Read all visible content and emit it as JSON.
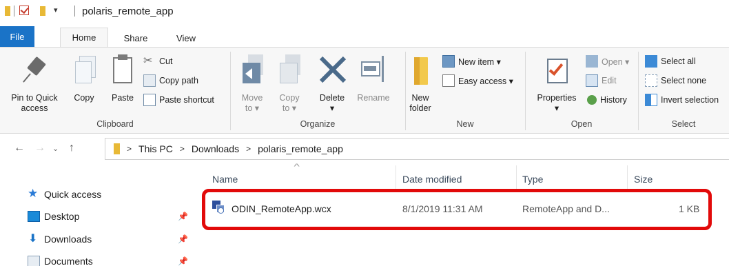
{
  "window": {
    "title": "polaris_remote_app",
    "qat_dropdown": "▾"
  },
  "ribbon_tabs": [
    {
      "label": "File"
    },
    {
      "label": "Home"
    },
    {
      "label": "Share"
    },
    {
      "label": "View"
    }
  ],
  "clipboard": {
    "label": "Clipboard",
    "pin_label_1": "Pin to Quick",
    "pin_label_2": "access",
    "copy_label": "Copy",
    "paste_label": "Paste",
    "cut_label": "Cut",
    "copy_path_label": "Copy path",
    "paste_shortcut_label": "Paste shortcut"
  },
  "organize": {
    "label": "Organize",
    "move_label": "Move",
    "move_sub": "to ▾",
    "copy_label": "Copy",
    "copy_sub": "to ▾",
    "delete_label": "Delete",
    "delete_sub": "▾",
    "rename_label": "Rename"
  },
  "new": {
    "label": "New",
    "new_folder_1": "New",
    "new_folder_2": "folder",
    "new_item_label": "New item ▾",
    "easy_access_label": "Easy access ▾"
  },
  "open": {
    "label": "Open",
    "properties_label": "Properties",
    "properties_sub": "▾",
    "open_label": "Open ▾",
    "edit_label": "Edit",
    "history_label": "History"
  },
  "select": {
    "label": "Select",
    "select_all": "Select all",
    "select_none": "Select none",
    "invert_selection": "Invert selection"
  },
  "nav": {
    "back": "←",
    "forward": "→",
    "recent": "⌄",
    "up": "↑"
  },
  "address": {
    "parts": [
      "This PC",
      "Downloads",
      "polaris_remote_app"
    ],
    "chevron": ">"
  },
  "leftnav": {
    "items": [
      {
        "label": "Quick access",
        "pinned": false
      },
      {
        "label": "Desktop",
        "pinned": true
      },
      {
        "label": "Downloads",
        "pinned": true
      },
      {
        "label": "Documents",
        "pinned": true
      }
    ]
  },
  "file_list": {
    "sort_indicator": "^",
    "columns": [
      "Name",
      "Date modified",
      "Type",
      "Size"
    ],
    "rows": [
      {
        "name": "ODIN_RemoteApp.wcx",
        "date": "8/1/2019 11:31 AM",
        "type": "RemoteApp and D...",
        "size": "1 KB"
      }
    ]
  },
  "colors": {
    "file_tab": "#1a73c7",
    "highlight": "#e20a0a",
    "folder": "#e8b936"
  }
}
